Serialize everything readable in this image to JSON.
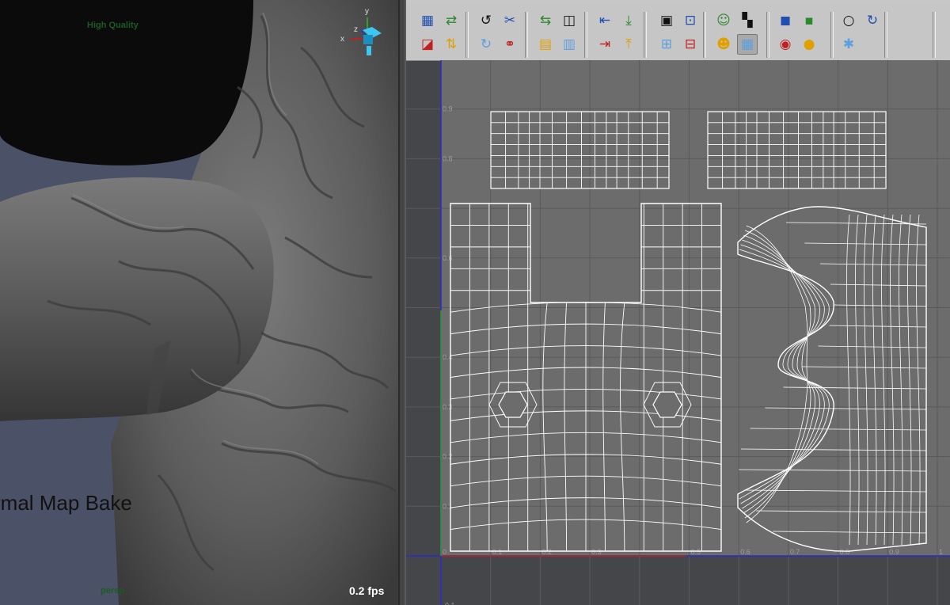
{
  "viewport": {
    "quality_label": "High Quality",
    "overlay_title": "rmal Map Bake",
    "camera_label": "persp",
    "fps_label": "0.2 fps",
    "axis_labels": {
      "y": "y",
      "x": "x",
      "z": "z"
    }
  },
  "uv_editor": {
    "toolbar_icons": [
      "checker-map-icon",
      "pin-uv-icon",
      "flip-u-icon",
      "flip-v-icon",
      "rotate-ccw-icon",
      "rotate-cw-icon",
      "cut-uv-icon",
      "sew-uv-icon",
      "move-sew-icon",
      "layout-icon",
      "unfold-icon",
      "relax-icon",
      "align-left-icon",
      "align-right-icon",
      "align-bottom-icon",
      "align-top-icon",
      "grid-icon",
      "grid-add-icon",
      "grid-snap-icon",
      "grid-remove-icon",
      "image-portrait-icon",
      "image-dim-icon",
      "checker-small-icon",
      "grid-display-icon",
      "shaded-uv-icon",
      "isolate-icon",
      "pixel-snap-icon",
      "rgb-channels-icon",
      "alpha-channel-icon",
      "uv-toolkit-icon",
      "refresh-icon"
    ],
    "active_tool": "grid-display-icon",
    "x_tick_labels": [
      "0.1",
      "0.2",
      "0.3",
      "0.5",
      "0.6",
      "0.7",
      "0.8",
      "0.9",
      "1"
    ],
    "y_tick_labels": [
      "0.9",
      "0.8",
      "0.6",
      "0.4",
      "0.3",
      "0.2",
      "0.1",
      "-0.1"
    ],
    "origin_label": "0"
  }
}
